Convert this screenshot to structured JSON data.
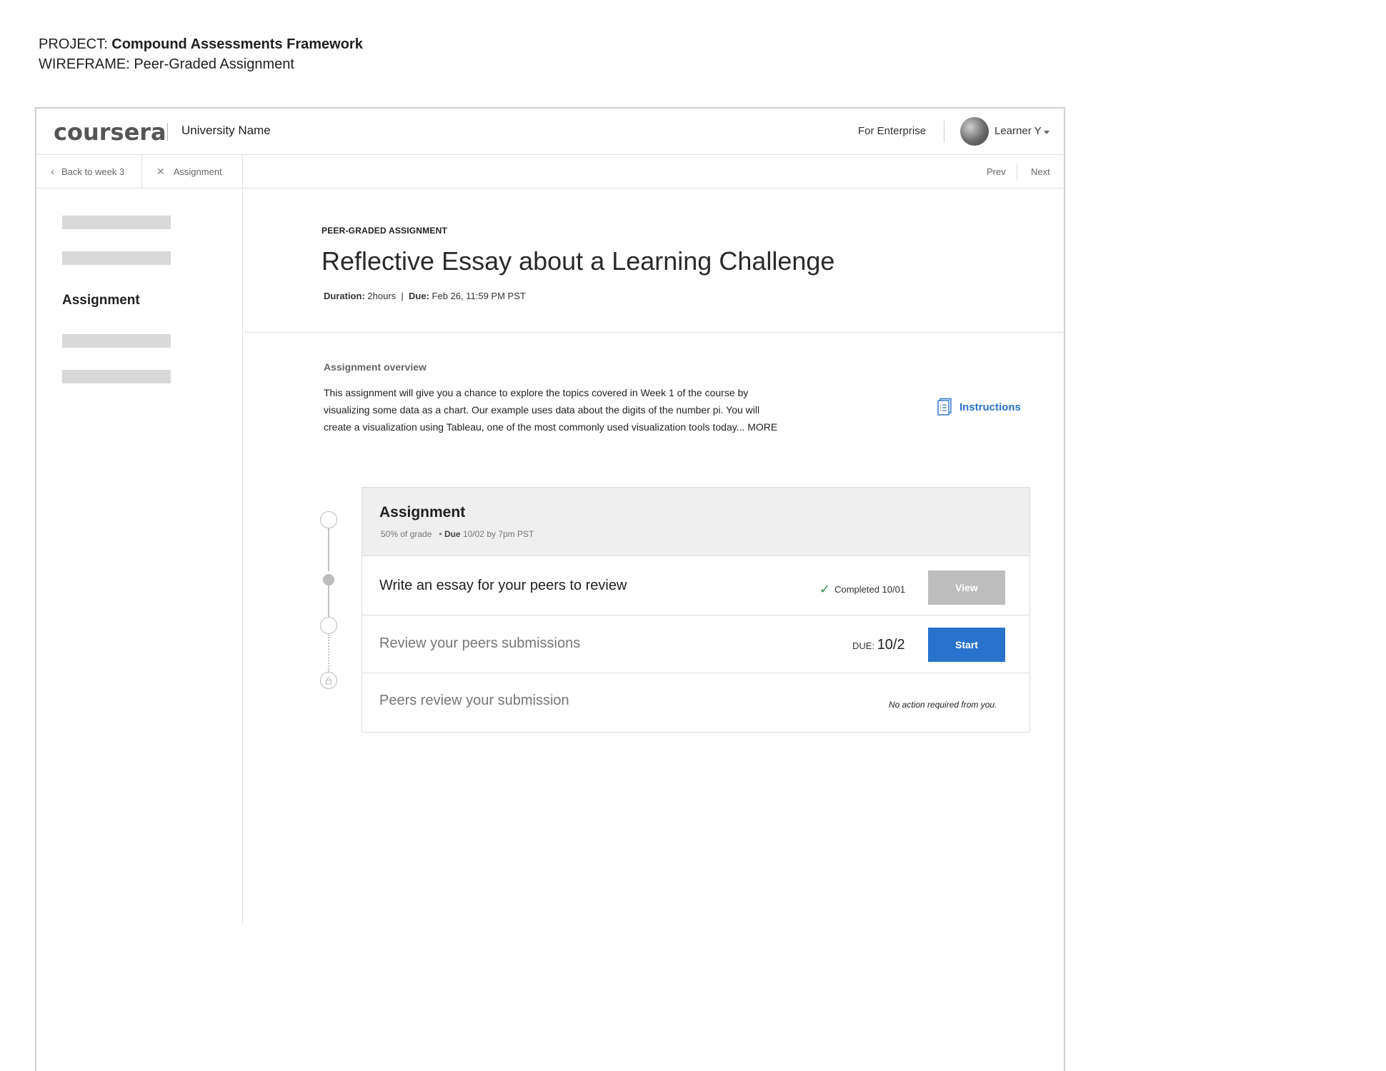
{
  "project": {
    "label": "PROJECT:",
    "name": "Compound Assessments Framework",
    "wireframe_label": "WIREFRAME:",
    "wireframe_name": "Peer-Graded Assignment"
  },
  "header": {
    "logo": "coursera",
    "university": "University Name",
    "enterprise": "For Enterprise",
    "user": "Learner Y"
  },
  "subnav": {
    "back": "Back to week 3",
    "assignment": "Assignment",
    "prev": "Prev",
    "next": "Next"
  },
  "sidebar": {
    "active_item": "Assignment"
  },
  "main": {
    "eyebrow": "PEER-GRADED ASSIGNMENT",
    "title": "Reflective Essay about a Learning Challenge",
    "duration_label": "Duration:",
    "duration_value": "2hours",
    "due_label": "Due:",
    "due_value": "Feb  26, 11:59 PM PST",
    "overview_label": "Assignment overview",
    "overview_text": "This assignment will give you a chance to explore the topics covered in Week 1 of the course by visualizing some data as a chart. Our example uses data about the digits of the number pi. You will create a visualization using Tableau, one of the most commonly used visualization tools today... MORE",
    "instructions_label": "Instructions"
  },
  "card": {
    "title": "Assignment",
    "grade": "50% of grade",
    "due_label": "Due",
    "due_value": "10/02 by 7pm PST",
    "steps": [
      {
        "title": "Write an essay for your peers to review",
        "status": "Completed 10/01",
        "button": "View"
      },
      {
        "title": "Review your peers submissions",
        "due_label": "DUE:",
        "due_value": "10/2",
        "button": "Start"
      },
      {
        "title": "Peers review your submission",
        "note": "No action required from you."
      }
    ]
  },
  "colors": {
    "accent": "#2a73cc",
    "disabled": "#bdbdbd",
    "placeholder": "#d9d9d9",
    "success": "#2e8b57"
  }
}
